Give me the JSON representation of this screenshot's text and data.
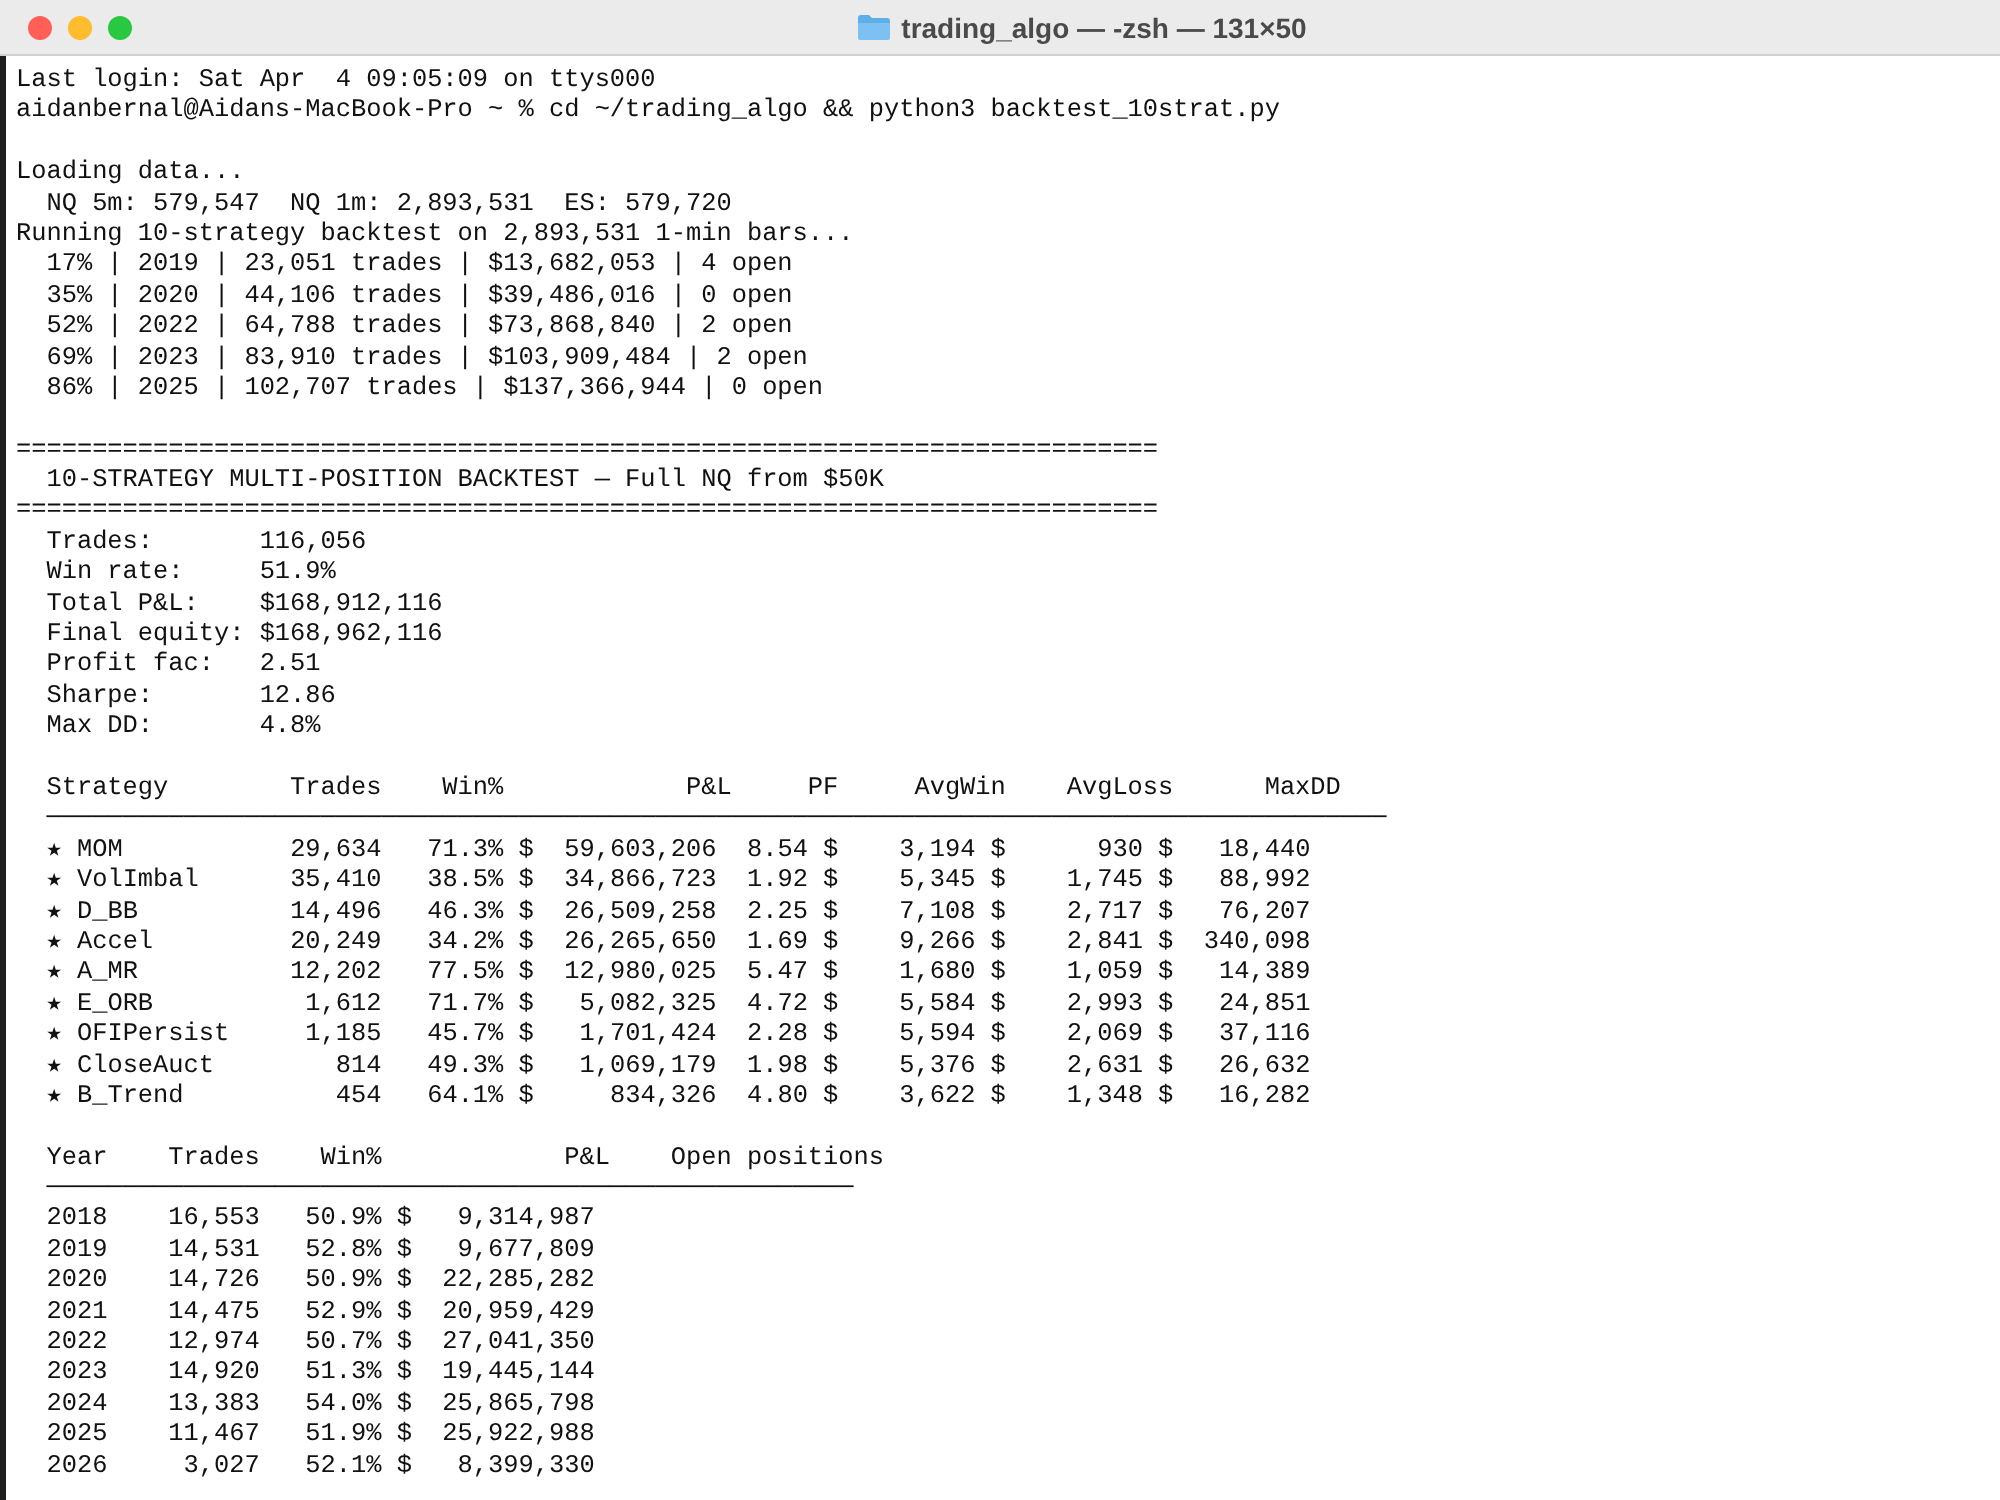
{
  "window": {
    "title": "trading_algo — -zsh — 131×50"
  },
  "terminal": {
    "blocks": [
      [
        "Last login: Sat Apr  4 09:05:09 on ttys000",
        "aidanbernal@Aidans-MacBook-Pro ~ % cd ~/trading_algo && python3 backtest_10strat.py"
      ],
      [
        "Loading data...",
        "  NQ 5m: 579,547  NQ 1m: 2,893,531  ES: 579,720",
        "Running 10-strategy backtest on 2,893,531 1-min bars...",
        "  17% | 2019 | 23,051 trades | $13,682,053 | 4 open",
        "  35% | 2020 | 44,106 trades | $39,486,016 | 0 open",
        "  52% | 2022 | 64,788 trades | $73,868,840 | 2 open",
        "  69% | 2023 | 83,910 trades | $103,909,484 | 2 open",
        "  86% | 2025 | 102,707 trades | $137,366,944 | 0 open"
      ],
      [
        "===========================================================================",
        "  10-STRATEGY MULTI-POSITION BACKTEST — Full NQ from $50K",
        "===========================================================================",
        "  Trades:       116,056",
        "  Win rate:     51.9%",
        "  Total P&L:    $168,912,116",
        "  Final equity: $168,962,116",
        "  Profit fac:   2.51",
        "  Sharpe:       12.86",
        "  Max DD:       4.8%"
      ],
      [
        "  Strategy        Trades    Win%            P&L     PF     AvgWin    AvgLoss      MaxDD",
        "  ────────────────────────────────────────────────────────────────────────────────────────",
        "  ★ MOM           29,634   71.3% $  59,603,206  8.54 $    3,194 $      930 $   18,440",
        "  ★ VolImbal      35,410   38.5% $  34,866,723  1.92 $    5,345 $    1,745 $   88,992",
        "  ★ D_BB          14,496   46.3% $  26,509,258  2.25 $    7,108 $    2,717 $   76,207",
        "  ★ Accel         20,249   34.2% $  26,265,650  1.69 $    9,266 $    2,841 $  340,098",
        "  ★ A_MR          12,202   77.5% $  12,980,025  5.47 $    1,680 $    1,059 $   14,389",
        "  ★ E_ORB          1,612   71.7% $   5,082,325  4.72 $    5,584 $    2,993 $   24,851",
        "  ★ OFIPersist     1,185   45.7% $   1,701,424  2.28 $    5,594 $    2,069 $   37,116",
        "  ★ CloseAuct        814   49.3% $   1,069,179  1.98 $    5,376 $    2,631 $   26,632",
        "  ★ B_Trend          454   64.1% $     834,326  4.80 $    3,622 $    1,348 $   16,282"
      ],
      [
        "  Year    Trades    Win%            P&L    Open positions",
        "  ─────────────────────────────────────────────────────",
        "  2018    16,553   50.9% $   9,314,987",
        "  2019    14,531   52.8% $   9,677,809",
        "  2020    14,726   50.9% $  22,285,282",
        "  2021    14,475   52.9% $  20,959,429",
        "  2022    12,974   50.7% $  27,041,350",
        "  2023    14,920   51.3% $  19,445,144",
        "  2024    13,383   54.0% $  25,865,798",
        "  2025    11,467   51.9% $  25,922,988",
        "  2026     3,027   52.1% $   8,399,330"
      ]
    ]
  }
}
